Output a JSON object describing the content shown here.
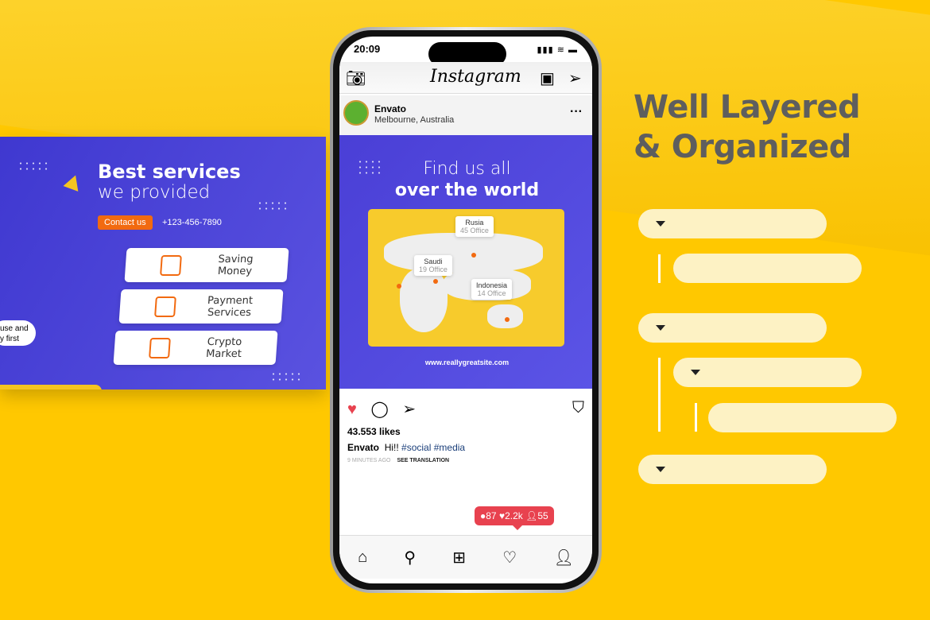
{
  "left_card": {
    "title_bold": "Best services",
    "title_light": "we provided",
    "contact_button": "Contact us",
    "phone": "+123-456-7890",
    "bubble_text": "use and\ny first",
    "services": [
      {
        "label": "Saving Money",
        "icon": "wallet-icon"
      },
      {
        "label": "Payment Services",
        "icon": "card-icon"
      },
      {
        "label": "Crypto Market",
        "icon": "chart-icon"
      }
    ]
  },
  "phone": {
    "time": "20:09",
    "status_icons": "▮▮▮ ≋ ▬",
    "app_title": "Instagram",
    "post_header": {
      "username": "Envato",
      "location": "Melbourne, Australia",
      "more": "···"
    },
    "post": {
      "title_light": "Find us all",
      "title_bold": "over the world",
      "website": "www.reallygreatsite.com",
      "locations": [
        {
          "name": "Rusia",
          "offices": "45 Office"
        },
        {
          "name": "Saudi",
          "offices": "19 Office"
        },
        {
          "name": "Indonesia",
          "offices": "14 Office"
        }
      ]
    },
    "likes": "43.553 likes",
    "caption_user": "Envato",
    "caption_text": "Hi!!",
    "hashtags": "#social #media",
    "time_ago": "9 MINUTES AGO",
    "see_translation": "SEE TRANSLATION",
    "notification": {
      "comments": "87",
      "likes": "2.2k",
      "followers": "55"
    },
    "accent": "#e8424f"
  },
  "headline": {
    "line1": "Well Layered",
    "line2": "& Organized"
  },
  "colors": {
    "background": "#ffc800",
    "brand_blue": "#4a3fd6",
    "orange": "#f26a10"
  }
}
